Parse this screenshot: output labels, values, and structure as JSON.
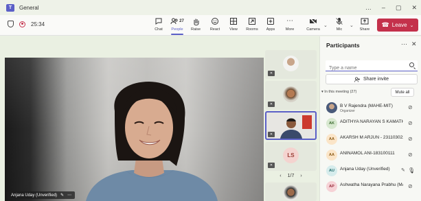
{
  "window": {
    "title": "General",
    "app_badge": "T"
  },
  "toolbar": {
    "timer": "25:34",
    "buttons": [
      {
        "id": "chat",
        "label": "Chat",
        "icon": "chat-icon"
      },
      {
        "id": "people",
        "label": "People",
        "icon": "people-icon",
        "count": "27"
      },
      {
        "id": "raise",
        "label": "Raise",
        "icon": "raise-hand-icon"
      },
      {
        "id": "react",
        "label": "React",
        "icon": "react-icon"
      },
      {
        "id": "view",
        "label": "View",
        "icon": "view-icon"
      },
      {
        "id": "rooms",
        "label": "Rooms",
        "icon": "rooms-icon"
      },
      {
        "id": "apps",
        "label": "Apps",
        "icon": "apps-icon"
      },
      {
        "id": "more",
        "label": "More",
        "icon": "more-icon"
      },
      {
        "id": "camera",
        "label": "Camera",
        "icon": "camera-icon"
      },
      {
        "id": "mic",
        "label": "Mic",
        "icon": "mic-icon"
      },
      {
        "id": "share",
        "label": "Share",
        "icon": "share-icon"
      }
    ],
    "leave_label": "Leave"
  },
  "main_video": {
    "name": "Anjana Uday (Unverified)"
  },
  "tiles": {
    "items": [
      {
        "type": "avatar-photo"
      },
      {
        "type": "avatar-photo"
      },
      {
        "type": "video",
        "selected": true
      },
      {
        "type": "initials",
        "initials": "LS"
      },
      {
        "type": "avatar-photo"
      }
    ],
    "pager": "1/7"
  },
  "panel": {
    "title": "Participants",
    "search_placeholder": "Type a name",
    "share_invite": "Share invite",
    "section_label": "In this meeting (27)",
    "mute_all": "Mute all",
    "participants": [
      {
        "name": "B V Rajendra (MAHE-MIT)",
        "role": "Organizer",
        "avatar": "photo",
        "mic": "muted"
      },
      {
        "name": "ADITHYA NARAYAN S KAMATH - 2...",
        "initials": "AK",
        "avatar_color": "#d8e8d0",
        "avatar_text": "#3b6b2e",
        "mic": "muted"
      },
      {
        "name": "AKARSH M ARJUN - 231103022",
        "initials": "AA",
        "avatar_color": "#fbe5c8",
        "avatar_text": "#8a5a14",
        "mic": "muted"
      },
      {
        "name": "ANINAMOL ANI-183100111",
        "initials": "AA",
        "avatar_color": "#fbe5c8",
        "avatar_text": "#8a5a14",
        "mic": "muted"
      },
      {
        "name": "Anjana Uday (Unverified)",
        "initials": "AU",
        "avatar_color": "#d6ecec",
        "avatar_text": "#1f6b6b",
        "mic": "on",
        "pinned": true
      },
      {
        "name": "Ashwatha Narayana Prabhu (MA...",
        "initials": "AP",
        "avatar_color": "#f6d2d6",
        "avatar_text": "#9a2f3c",
        "mic": "muted"
      }
    ]
  },
  "colors": {
    "accent": "#5b5fc7",
    "leave": "#c4314b"
  }
}
